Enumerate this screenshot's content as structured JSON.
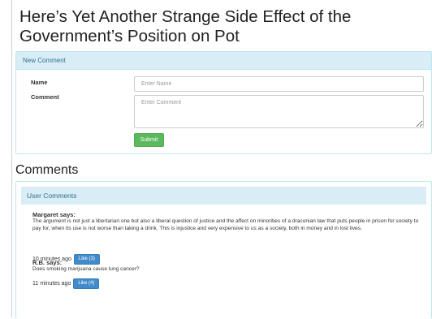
{
  "article": {
    "title": "Here’s Yet Another Strange Side Effect of the Government’s Position on Pot"
  },
  "new_comment": {
    "heading": "New Comment",
    "name_label": "Name",
    "name_placeholder": "Enter Name",
    "comment_label": "Comment",
    "comment_placeholder": "Enter Comment",
    "submit_label": "Submit"
  },
  "comments_section": {
    "heading": "Comments",
    "panel_heading": "User Comments",
    "comments": [
      {
        "author": "Margaret says:",
        "body": "The argument is not just a libertarian one but also a liberal question of justice and the affect on minorities of a draconian law that puts people in prison for society to pay for, when its use is not worse than taking a drink. This is injustice and very expensive to us as a society, both in money and in lost lives.",
        "time": "10 minutes ago",
        "like_label": "Like (3)"
      },
      {
        "author": "R.B. says:",
        "body": "Does smoking marijuana cause lung cancer?",
        "time": "11 minutes ago",
        "like_label": "Like (4)"
      }
    ]
  }
}
